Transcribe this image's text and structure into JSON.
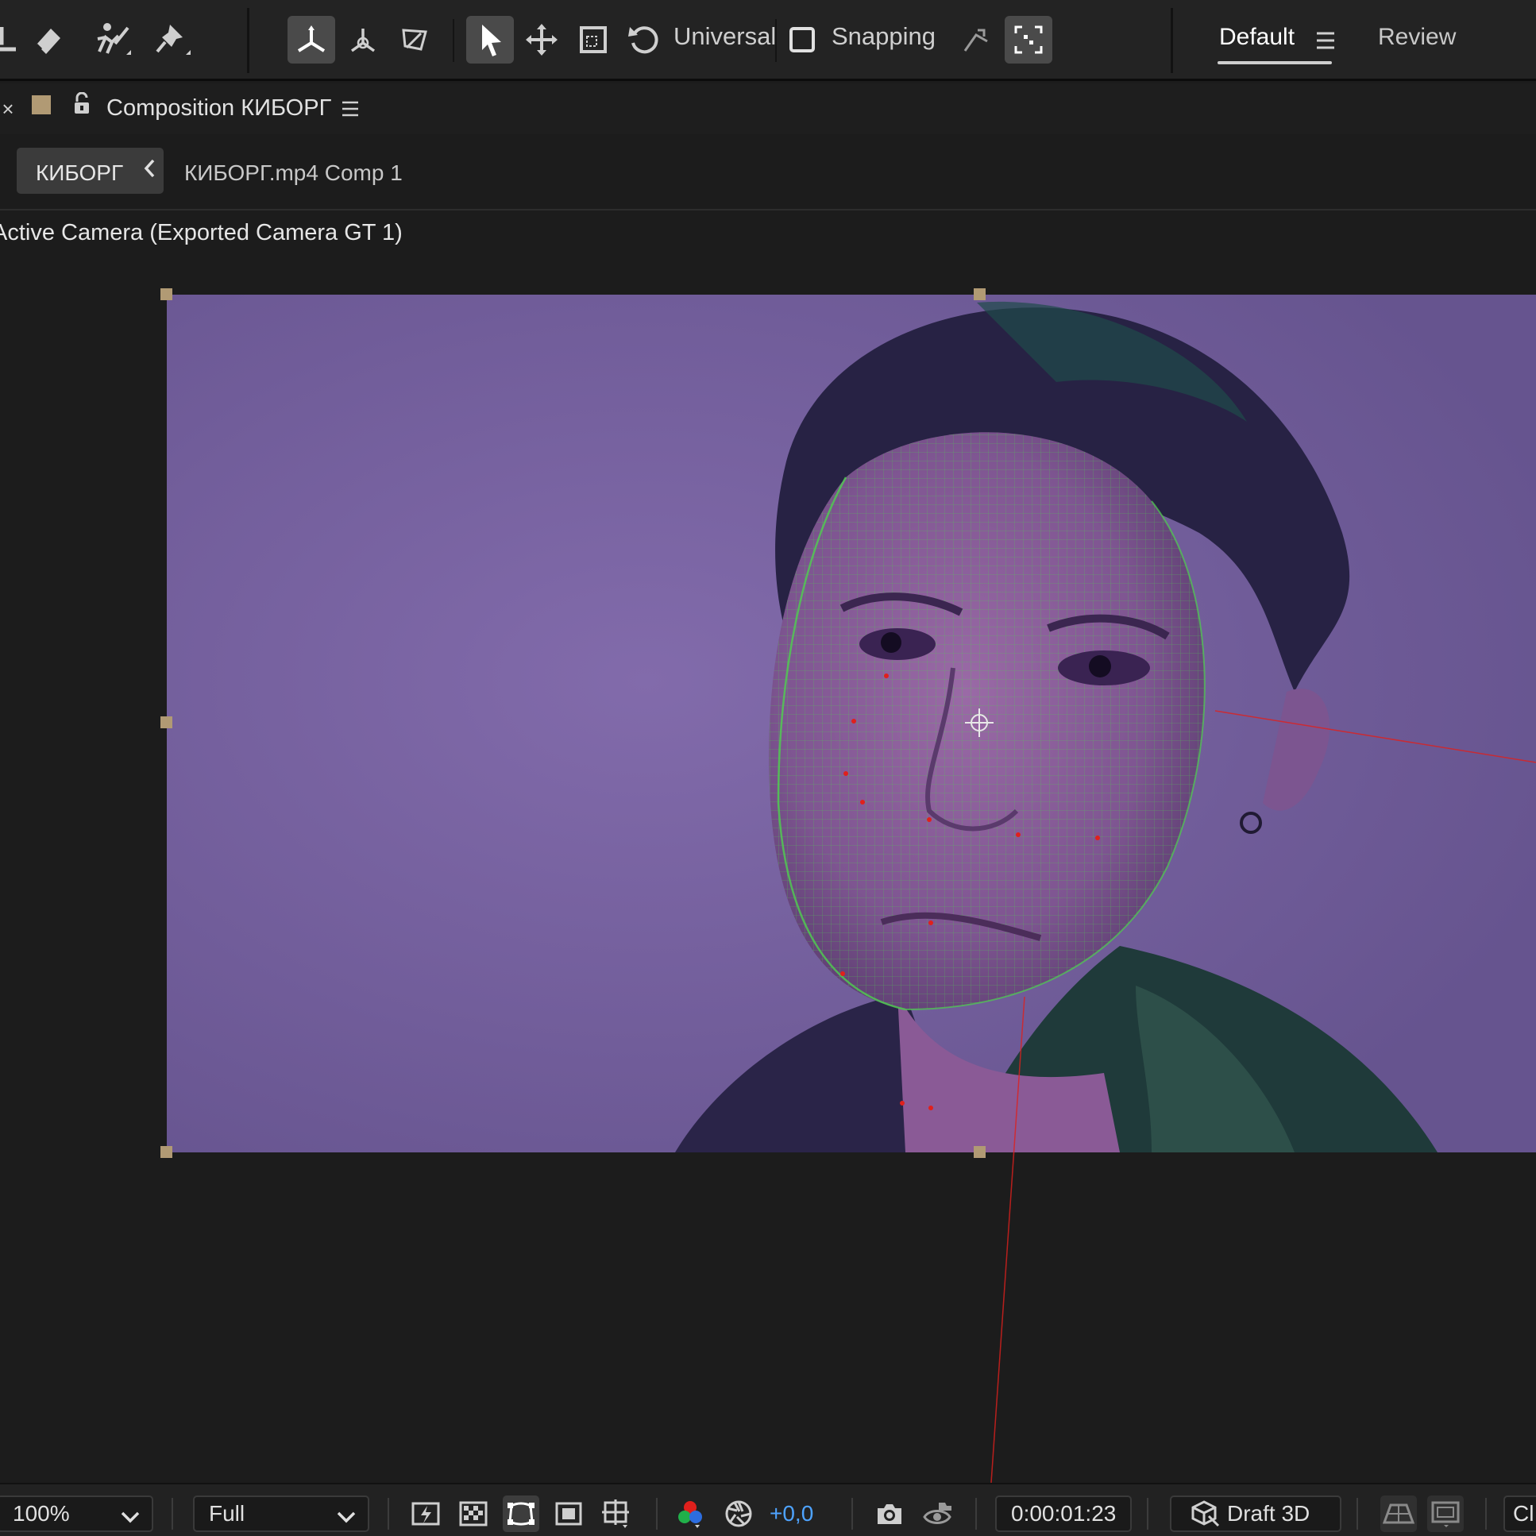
{
  "toolbar": {
    "universal_label": "Universal",
    "snapping_label": "Snapping",
    "workspaces": {
      "default": "Default",
      "review": "Review"
    }
  },
  "panel": {
    "title": "Composition КИБОРГ",
    "label_color": "#b19a74"
  },
  "breadcrumbs": {
    "active": "КИБОРГ",
    "next": "КИБОРГ.mp4 Comp 1"
  },
  "viewer": {
    "view_label": "Active Camera (Exported Camera GT 1)"
  },
  "bottom_bar": {
    "zoom": "100%",
    "resolution": "Full",
    "exposure": "+0,0",
    "timecode": "0:00:01:23",
    "renderer": "Draft 3D",
    "truncated_label": "Cl"
  },
  "colors": {
    "accent": "#4ea3ff",
    "mesh": "#4fd04f",
    "tracker_point": "#e0201c",
    "handle": "#b19a74"
  }
}
